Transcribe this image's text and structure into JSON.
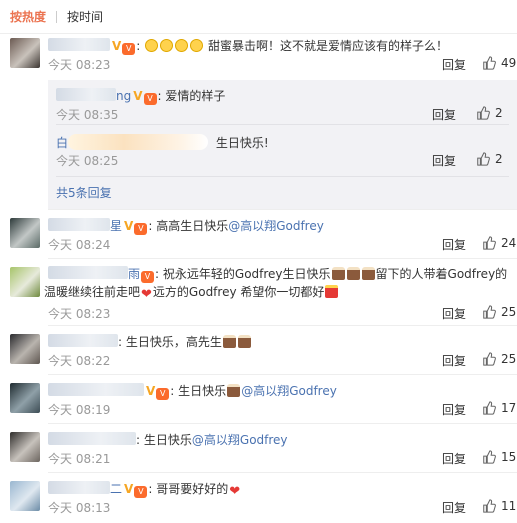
{
  "sort": {
    "hot_label": "按热度",
    "time_label": "按时间"
  },
  "comments": [
    {
      "name_suffix": "",
      "text": "甜蜜暴击啊！这不就是爱情应该有的样子么！",
      "text2": "",
      "time": "今天 08:23",
      "reply_label": "回复",
      "likes": "49",
      "avatar_colors": [
        "#6b5a52",
        "#c9c2bb",
        "#3a3430"
      ]
    },
    {
      "name_suffix": "星",
      "text": "高高生日快乐",
      "mention": "@高以翔Godfrey",
      "text2": "",
      "time": "今天 08:24",
      "reply_label": "回复",
      "likes": "24",
      "avatar_colors": [
        "#2d3a3a",
        "#c2c7c6",
        "#5a6a66"
      ]
    },
    {
      "name_suffix": "雨",
      "text": "祝永远年轻的Godfrey生日快乐",
      "text_b": "留下的人带着Godfrey的",
      "text2": "温暖继续往前走吧",
      "text2_b": "远方的Godfrey 希望你一切都好",
      "time": "今天 08:23",
      "reply_label": "回复",
      "likes": "25",
      "avatar_colors": [
        "#a7c46a",
        "#e7eadb",
        "#6f8a3e"
      ]
    },
    {
      "name_suffix": "",
      "text": "生日快乐，高先生",
      "text2": "",
      "time": "今天 08:22",
      "reply_label": "回复",
      "likes": "25",
      "avatar_colors": [
        "#2a2a2e",
        "#b9b4ae",
        "#5e5650"
      ]
    },
    {
      "name_suffix": "",
      "text": "生日快乐",
      "mention": "@高以翔Godfrey",
      "text2": "",
      "time": "今天 08:19",
      "reply_label": "回复",
      "likes": "17",
      "avatar_colors": [
        "#1f2b30",
        "#8fa0a8",
        "#3c4c54"
      ]
    },
    {
      "name_suffix": "",
      "text": "生日快乐",
      "mention": "@高以翔Godfrey",
      "text2": "",
      "time": "今天 08:21",
      "reply_label": "回复",
      "likes": "15",
      "avatar_colors": [
        "#2f2d2b",
        "#c7c2bc",
        "#6b645e"
      ]
    },
    {
      "name_suffix": "二",
      "text": "哥哥要好好的",
      "text2": "",
      "time": "今天 08:13",
      "reply_label": "回复",
      "likes": "11",
      "avatar_colors": [
        "#9ab7d0",
        "#dfe8f0",
        "#6b8ba6"
      ]
    }
  ],
  "subreplies": [
    {
      "name_suffix": "ng",
      "text": "爱情的样子",
      "time": "今天 08:35",
      "reply_label": "回复",
      "likes": "2"
    },
    {
      "name_prefix": "白",
      "text": "生日快乐!",
      "time": "今天 08:25",
      "reply_label": "回复",
      "likes": "2"
    }
  ],
  "more_replies": "共5条回复",
  "icons": {
    "like": "thumbs-up-icon",
    "verified": "v-icon",
    "vip": "vip-icon"
  },
  "colors": {
    "accent": "#eb7350",
    "link": "#4a72b0",
    "muted": "#999999"
  }
}
